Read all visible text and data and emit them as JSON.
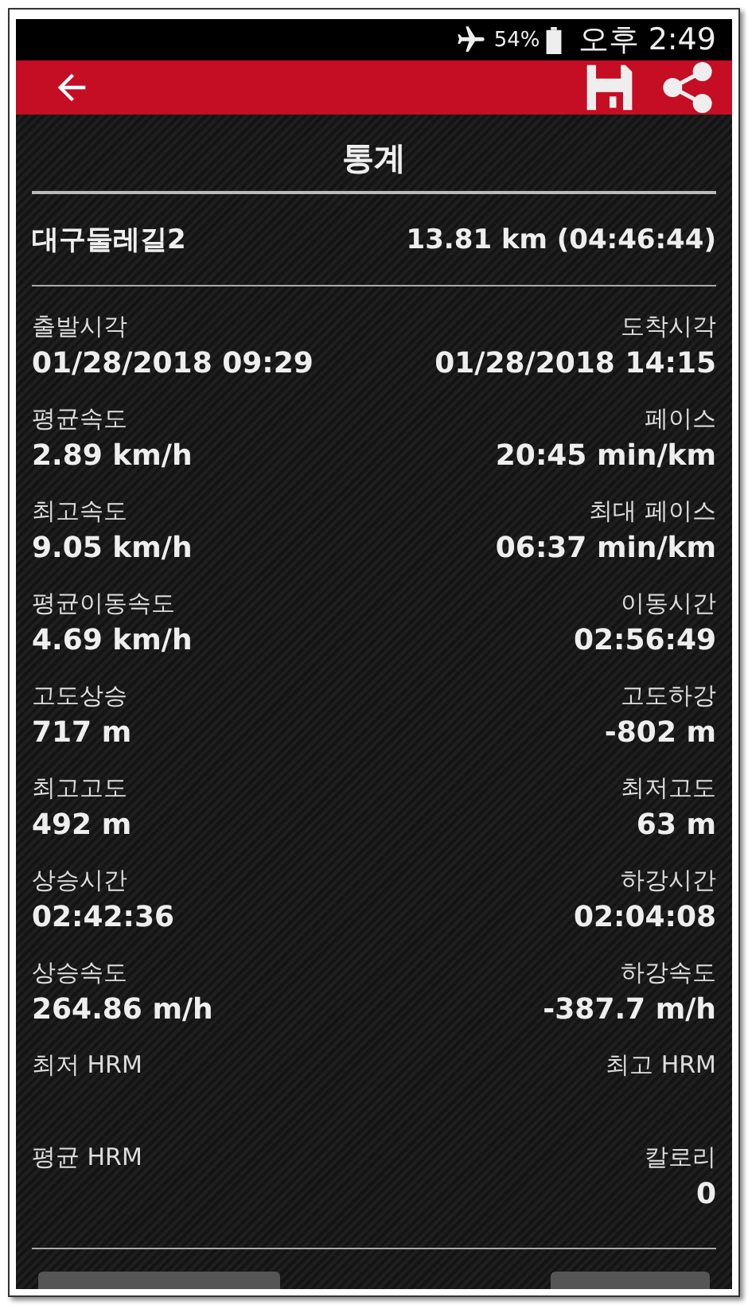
{
  "status_bar": {
    "battery": "54%",
    "time": "오후 2:49"
  },
  "title": "통계",
  "track": {
    "name": "대구둘레길2",
    "summary": "13.81 km (04:46:44)"
  },
  "stats": [
    {
      "left": {
        "label": "출발시각",
        "value": "01/28/2018 09:29"
      },
      "right": {
        "label": "도착시각",
        "value": "01/28/2018 14:15"
      }
    },
    {
      "left": {
        "label": "평균속도",
        "value": "2.89 km/h"
      },
      "right": {
        "label": "페이스",
        "value": "20:45 min/km"
      }
    },
    {
      "left": {
        "label": "최고속도",
        "value": "9.05 km/h"
      },
      "right": {
        "label": "최대 페이스",
        "value": "06:37 min/km"
      }
    },
    {
      "left": {
        "label": "평균이동속도",
        "value": "4.69 km/h"
      },
      "right": {
        "label": "이동시간",
        "value": "02:56:49"
      }
    },
    {
      "left": {
        "label": "고도상승",
        "value": "717 m"
      },
      "right": {
        "label": "고도하강",
        "value": "-802 m"
      }
    },
    {
      "left": {
        "label": "최고고도",
        "value": "492 m"
      },
      "right": {
        "label": "최저고도",
        "value": "63 m"
      }
    },
    {
      "left": {
        "label": "상승시간",
        "value": "02:42:36"
      },
      "right": {
        "label": "하강시간",
        "value": "02:04:08"
      }
    },
    {
      "left": {
        "label": "상승속도",
        "value": "264.86 m/h"
      },
      "right": {
        "label": "하강속도",
        "value": "-387.7 m/h"
      }
    },
    {
      "left": {
        "label": "최저 HRM"
      },
      "right": {
        "label": "최고 HRM"
      }
    },
    {
      "left": {
        "label": "평균 HRM"
      },
      "right": {
        "label": "칼로리",
        "value": "0"
      }
    }
  ]
}
